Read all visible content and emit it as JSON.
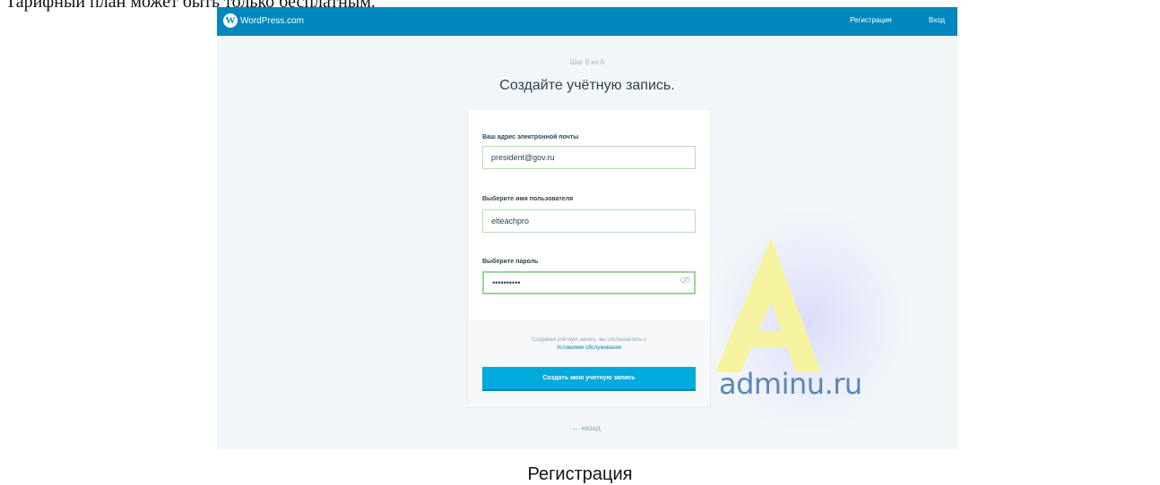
{
  "page": {
    "top_caption": "Тарифный план может быть только бесплатным.",
    "bottom_caption": "Регистрация"
  },
  "header": {
    "logo_text": "WordPress.com",
    "logo_icon": "wordpress-icon",
    "signup_label": "Регистрация",
    "login_label": "Вход",
    "bar_color": "#0087be"
  },
  "form": {
    "step": "Шаг 6 из 6",
    "title": "Создайте учётную запись.",
    "email_label": "Ваш адрес электронной почты",
    "email_value": "president@gov.ru",
    "username_label": "Выберите имя пользователя",
    "username_value": "elteachpro",
    "password_label": "Выберите пароль",
    "password_value": "••••••••••",
    "password_toggle_icon": "eye-off-icon",
    "terms_text": "Создавая учётную запись, вы соглашаетесь с",
    "terms_link": "Условиями обслуживания",
    "submit_label": "Создать мою учетную запись",
    "submit_color": "#00aadc",
    "back_label": "← назад"
  },
  "watermark": {
    "text": "adminu.ru",
    "mark_color": "#f6f3a0"
  }
}
